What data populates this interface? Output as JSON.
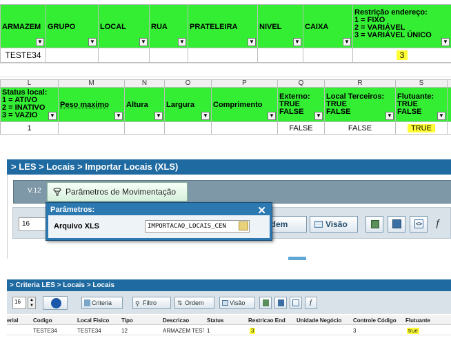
{
  "sheet1": {
    "headers": [
      "ARMAZEM",
      "GRUPO",
      "LOCAL",
      "RUA",
      "PRATELEIRA",
      "NIVEL",
      "CAIXA"
    ],
    "restr_header": [
      "Restrição endereço:",
      "1 = FIXO",
      "2 = VARIÁVEL",
      "3 = VARIÁVEL ÚNICO"
    ],
    "row": {
      "armazem": "TESTE34",
      "restricao": "3"
    }
  },
  "sheet2": {
    "col_letters": [
      "L",
      "M",
      "N",
      "O",
      "P",
      "Q",
      "R",
      "S"
    ],
    "status_header": [
      "Status local:",
      "1 = ATIVO",
      "2 = INATIVO",
      "3 = VAZIO"
    ],
    "headers": [
      "Peso maximo",
      "Altura",
      "Largura",
      "Comprimento"
    ],
    "externo": [
      "Externo:",
      "TRUE",
      "FALSE"
    ],
    "local_terceiros": [
      "Local Terceiros:",
      "TRUE",
      "FALSE"
    ],
    "flutuante": [
      "Flutuante:",
      "TRUE",
      "FALSE"
    ],
    "row": {
      "status": "1",
      "externo": "FALSE",
      "local_terceiros": "FALSE",
      "flutuante": "TRUE"
    }
  },
  "les": {
    "title": "> LES > Locais > Importar Locais (XLS)",
    "version": "V.12",
    "param_btn": "Parâmetros de Movimentação",
    "page_num": "16",
    "ordem": "rdem",
    "visao": "Visão",
    "popup_title": "Parâmetros:",
    "close": "✕",
    "file_label": "Arquivo XLS",
    "file_value": "IMPORTACAO_LOCAIS_CEN"
  },
  "crit": {
    "title": "> Criteria LES > Locais > Locais",
    "page_num": "16",
    "criteria": "Criteria",
    "filtro": "Filtro",
    "ordem": "Ordem",
    "visao": "Visão",
    "columns": [
      "erial",
      "Codigo",
      "Local Fisico",
      "Tipo",
      "Descricao",
      "Status",
      "Restricao End",
      "Unidade Negócio",
      "Controle Código",
      "Flutuante"
    ],
    "row": [
      "",
      "TESTE34",
      "TESTE34",
      "12",
      "ARMAZEM TESTE",
      "1",
      "3",
      "",
      "3",
      "true"
    ]
  },
  "colors": {
    "header_green": "#33ee33",
    "highlight": "#ffff33",
    "les_blue": "#1e6aa1"
  }
}
